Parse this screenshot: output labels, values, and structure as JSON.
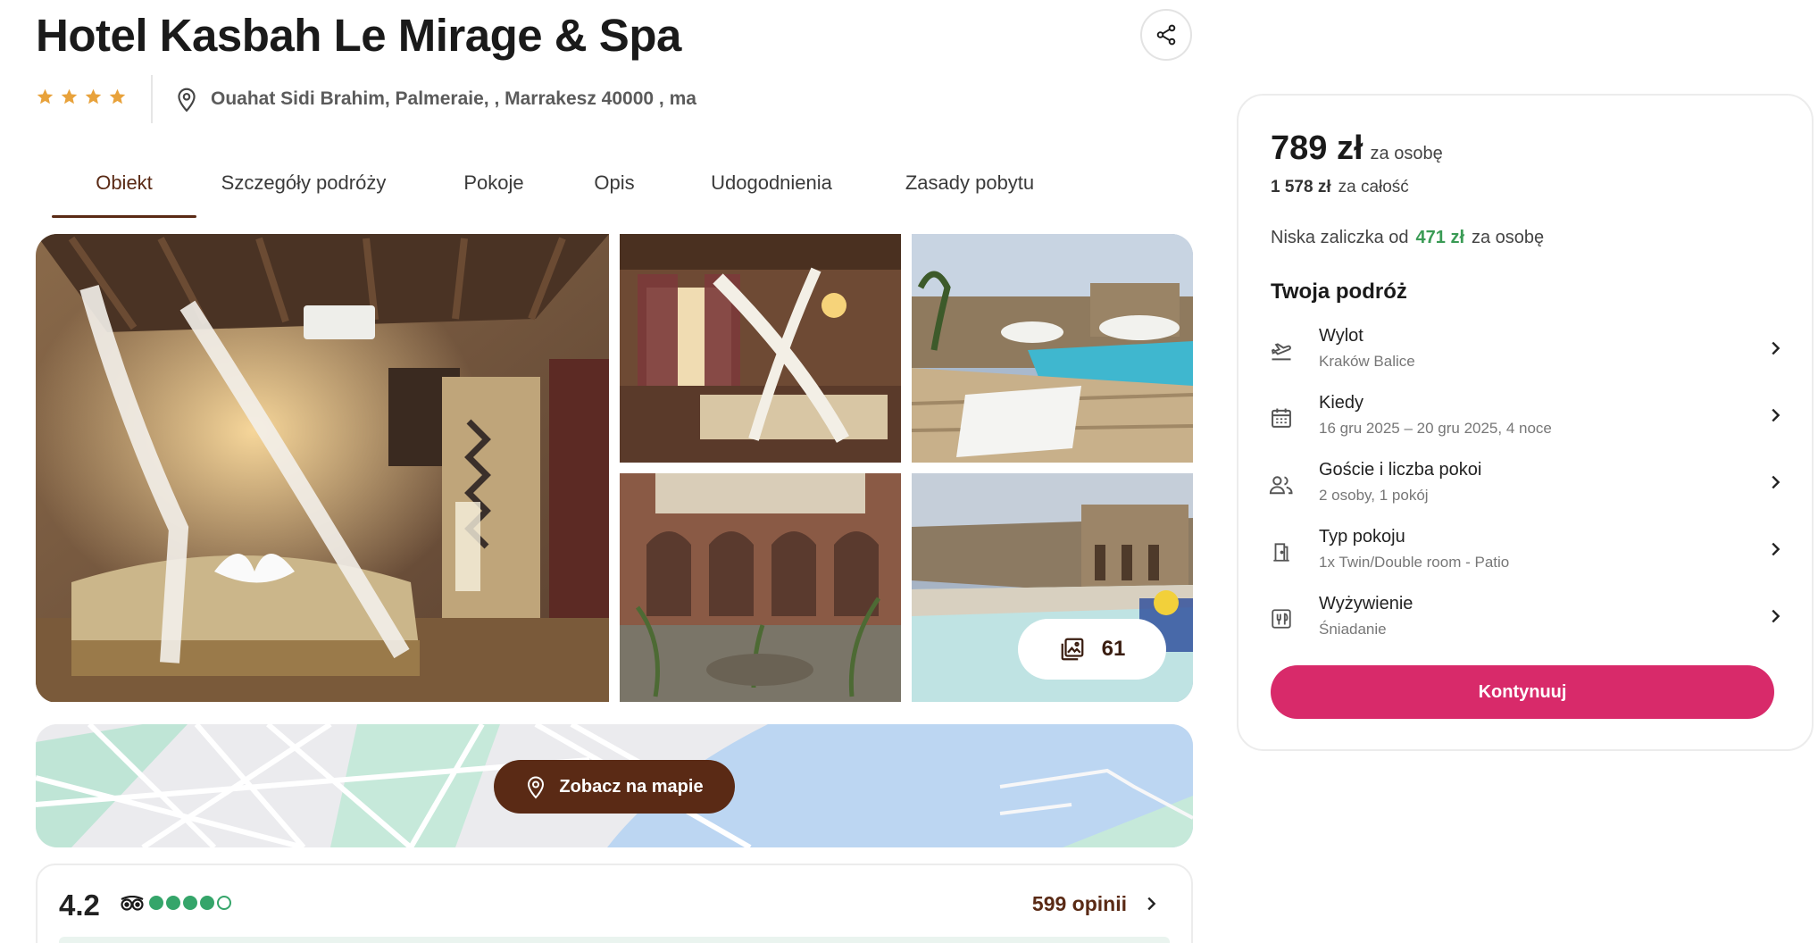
{
  "hotel": {
    "title": "Hotel Kasbah Le Mirage & Spa",
    "stars": 4,
    "address": "Ouahat Sidi Brahim, Palmeraie, , Marrakesz 40000 , ma"
  },
  "tabs": [
    {
      "label": "Obiekt",
      "active": true
    },
    {
      "label": "Szczegóły podróży",
      "active": false
    },
    {
      "label": "Pokoje",
      "active": false
    },
    {
      "label": "Opis",
      "active": false
    },
    {
      "label": "Udogodnienia",
      "active": false
    },
    {
      "label": "Zasady pobytu",
      "active": false
    }
  ],
  "gallery": {
    "photo_count": "61"
  },
  "map": {
    "button_label": "Zobacz na mapie"
  },
  "reviews": {
    "rating": "4.2",
    "bubbles_filled": 4,
    "bubbles_total": 5,
    "count_label": "599 opinii"
  },
  "booking": {
    "price": "789 zł",
    "price_per": "za osobę",
    "total": "1 578 zł",
    "total_label": "za całość",
    "deposit_prefix": "Niska zaliczka od",
    "deposit_amount": "471 zł",
    "deposit_suffix": "za osobę",
    "trip_title": "Twoja podróż",
    "items": [
      {
        "label": "Wylot",
        "value": "Kraków Balice",
        "icon": "plane-departure-icon"
      },
      {
        "label": "Kiedy",
        "value": "16 gru 2025 – 20 gru 2025, 4 noce",
        "icon": "calendar-icon"
      },
      {
        "label": "Goście i liczba pokoi",
        "value": "2 osoby, 1 pokój",
        "icon": "people-icon"
      },
      {
        "label": "Typ pokoju",
        "value": "1x Twin/Double room - Patio",
        "icon": "door-icon"
      },
      {
        "label": "Wyżywienie",
        "value": "Śniadanie",
        "icon": "meal-icon"
      }
    ],
    "continue_label": "Kontynuuj"
  },
  "colors": {
    "brand_brown": "#5a2a15",
    "cta_pink": "#d82a6a",
    "star_gold": "#e8a23b",
    "tripadvisor_green": "#35a56a",
    "deposit_green": "#3a9b55"
  }
}
